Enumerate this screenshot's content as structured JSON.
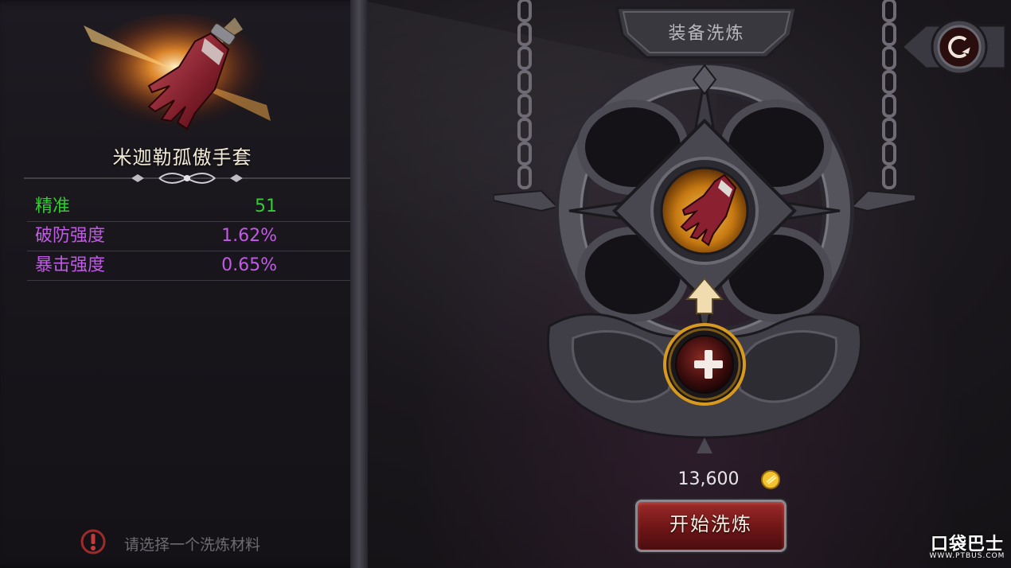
{
  "item_panel": {
    "item_name": "米迦勒孤傲手套",
    "stats": [
      {
        "name": "精准",
        "value": "51",
        "color": "#33cc33"
      },
      {
        "name": "破防强度",
        "value": "1.62%",
        "color": "#c15ae6"
      },
      {
        "name": "暴击强度",
        "value": "0.65%",
        "color": "#c15ae6"
      }
    ],
    "hint": "请选择一个洗炼材料",
    "hint_icon": "alert-icon"
  },
  "refine": {
    "title": "装备洗炼",
    "slot_item_icon": "glove-icon",
    "add_icon": "plus-icon",
    "arrow_icon": "arrow-up-icon",
    "cost": "13,600",
    "currency_icon": "gold-coin-icon",
    "start_label": "开始洗炼",
    "back_icon": "return-arrow-icon"
  },
  "watermark": {
    "text": "口袋巴士",
    "sub": "WWW.PTBUS.COM"
  }
}
